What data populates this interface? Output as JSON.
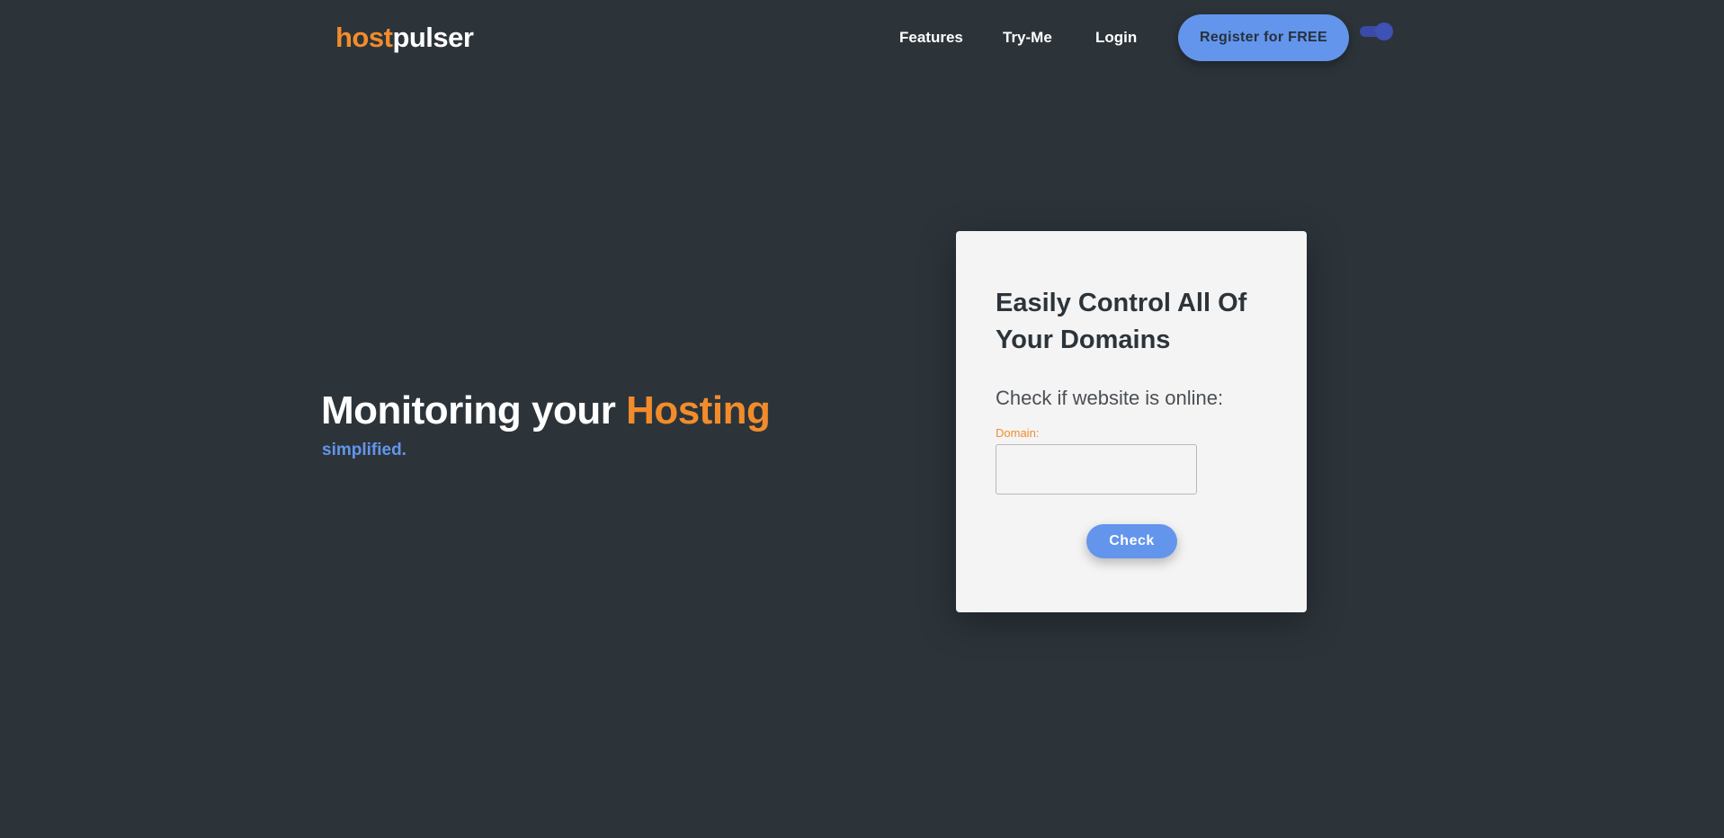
{
  "header": {
    "logo": {
      "part1": "host",
      "part2": "pulser"
    },
    "nav": {
      "features": "Features",
      "tryme": "Try-Me",
      "login": "Login"
    },
    "register_label": "Register for FREE"
  },
  "theme_toggle": {
    "state": "on"
  },
  "hero": {
    "title_main": "Monitoring your ",
    "title_accent": "Hosting",
    "subtitle": "simplified."
  },
  "card": {
    "title": "Easily Control All Of Your Domains",
    "subtitle": "Check if website is online:",
    "domain_label": "Domain:",
    "domain_value": "",
    "check_label": "Check"
  },
  "colors": {
    "background": "#2c343a",
    "accent_orange": "#f28c2b",
    "accent_blue": "#6395ec",
    "card": "#f4f4f4"
  }
}
